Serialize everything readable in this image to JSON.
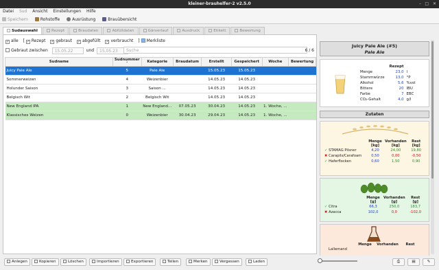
{
  "window": {
    "title": "kleiner-brauhelfer-2 v2.5.0"
  },
  "menu": [
    "Datei",
    "Sud",
    "Ansicht",
    "Einstellungen",
    "Hilfe"
  ],
  "toolbar": {
    "save": "Speichern",
    "ingredients": "Rohstoffe",
    "equipment": "Ausrüstung",
    "overview": "Brauübersicht"
  },
  "tabs": [
    "Sudauswahl",
    "Rezept",
    "Braudaten",
    "Abfülldaten",
    "Gärverlauf",
    "Ausdruck",
    "Etikett",
    "Bewertung"
  ],
  "filters": {
    "all": "alle",
    "recipe": "Rezept",
    "brewed": "gebraut",
    "bottled": "abgefüllt",
    "consumed": "verbraucht",
    "bookmarks": "Merkliste",
    "between": "Gebraut zwischen",
    "date_from": "15.05.22",
    "and": "und",
    "date_to": "15.05.23",
    "search_placeholder": "Suche",
    "count": "6 / 6"
  },
  "table": {
    "columns": [
      "Sudname",
      "Sudnummer",
      "Kategorie",
      "Braudatum",
      "Erstellt",
      "Gespeichert",
      "Woche",
      "Bewertung"
    ],
    "rows": [
      {
        "name": "Juicy Pale Ale",
        "nr": "5",
        "kat": "Pale Ale",
        "brau": "",
        "erstellt": "15.05.23",
        "gesp": "15.05.23",
        "woche": "",
        "bew": "",
        "state": "selected"
      },
      {
        "name": "Sommerweizen",
        "nr": "4",
        "kat": "Weizenbier",
        "brau": "",
        "erstellt": "14.05.23",
        "gesp": "14.05.23",
        "woche": "",
        "bew": "",
        "state": "normal"
      },
      {
        "name": "Holunder Saison",
        "nr": "3",
        "kat": "Saison ...",
        "brau": "",
        "erstellt": "14.05.23",
        "gesp": "14.05.23",
        "woche": "",
        "bew": "",
        "state": "normal"
      },
      {
        "name": "Belgisch Wit",
        "nr": "2",
        "kat": "Belgisch Wit",
        "brau": "",
        "erstellt": "14.05.23",
        "gesp": "14.05.23",
        "woche": "",
        "bew": "",
        "state": "normal"
      },
      {
        "name": "New England IPA",
        "nr": "1",
        "kat": "New England...",
        "brau": "07.05.23",
        "erstellt": "30.04.23",
        "gesp": "14.05.23",
        "woche": "1. Woche, ...",
        "bew": "",
        "state": "brewed"
      },
      {
        "name": "Klassisches Weizen",
        "nr": "0",
        "kat": "Weizenbier",
        "brau": "30.04.23",
        "erstellt": "29.04.23",
        "gesp": "14.05.23",
        "woche": "1. Woche, ...",
        "bew": "",
        "state": "brewed"
      }
    ]
  },
  "bottom_buttons": [
    "Anlegen",
    "Kopieren",
    "Löschen",
    "Importieren",
    "Exportieren",
    "Teilen",
    "Merken",
    "Vergessen",
    "Laden"
  ],
  "recipe": {
    "title": "Juicy Pale Ale (#5)",
    "subtitle": "Pale Ale",
    "col": "Rezept",
    "stats": [
      {
        "label": "Menge",
        "value": "23,0",
        "unit": "l"
      },
      {
        "label": "Stammwürze",
        "value": "13,0",
        "unit": "°P"
      },
      {
        "label": "Alkohol",
        "value": "5,6",
        "unit": "%vol"
      },
      {
        "label": "Bittere",
        "value": "20",
        "unit": "IBU"
      },
      {
        "label": "Farbe",
        "value": "7",
        "unit": "EBC"
      },
      {
        "label": "CO₂-Gehalt",
        "value": "4,0",
        "unit": "g/l"
      }
    ]
  },
  "zutaten": {
    "title": "Zutaten",
    "malt": {
      "headers": [
        "Menge [kg]",
        "Vorhanden [kg]",
        "Rest [kg]"
      ],
      "rows": [
        {
          "name": "STAMAG Pilsner",
          "menge": "4,20",
          "vorh": "24,00",
          "rest": "19,80",
          "ok": true
        },
        {
          "name": "Carapils/Carafoam",
          "menge": "0,50",
          "vorh": "0,00",
          "rest": "-0,50",
          "ok": false
        },
        {
          "name": "Haferflocken",
          "menge": "0,60",
          "vorh": "1,50",
          "rest": "0,90",
          "ok": true
        }
      ]
    },
    "hops": {
      "headers": [
        "Menge [g]",
        "Vorhanden [g]",
        "Rest [g]"
      ],
      "rows": [
        {
          "name": "Citra",
          "menge": "66,3",
          "vorh": "250,0",
          "rest": "183,7",
          "ok": true
        },
        {
          "name": "Azacca",
          "menge": "102,0",
          "vorh": "0,0",
          "rest": "-102,0",
          "ok": false
        }
      ]
    },
    "yeast": {
      "headers": [
        "Menge",
        "Vorhanden",
        "Rest"
      ],
      "rows": [
        {
          "name": "Lallemand"
        }
      ]
    }
  },
  "colors": {
    "selected": "#1e73d2",
    "brewed": "#c6eac0",
    "malt_bg": "#fdf6e3",
    "hop_bg": "#e4f7e4",
    "yeast_bg": "#fde9dc"
  }
}
